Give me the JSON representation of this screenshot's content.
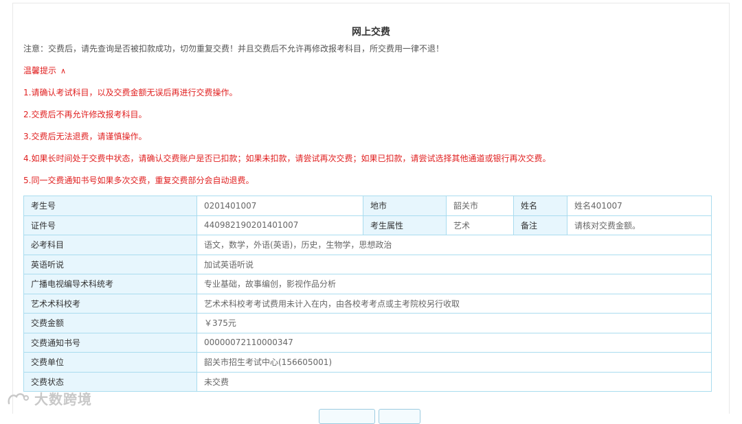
{
  "page": {
    "title": "网上交费",
    "notice": "注意：交费后，请先查询是否被扣款成功，切勿重复交费！并且交费后不允许再修改报考科目，所交费用一律不退！"
  },
  "tips": {
    "toggle_label": "温馨提示",
    "toggle_icon": "chevron-up-icon",
    "items": [
      "1.请确认考试科目，以及交费金额无误后再进行交费操作。",
      "2.交费后不再允许修改报考科目。",
      "3.交费后无法退费，请谨慎操作。",
      "4.如果长时间处于交费中状态，请确认交费账户是否已扣款；如果未扣款，请尝试再次交费；如果已扣款，请尝试选择其他通道或银行再次交费。",
      "5.同一交费通知书号如果多次交费，重复交费部分会自动退费。"
    ]
  },
  "table": {
    "row1": {
      "label1": "考生号",
      "value1": "0201401007",
      "label2": "地市",
      "value2": "韶关市",
      "label3": "姓名",
      "value3": "姓名401007"
    },
    "row2": {
      "label1": "证件号",
      "value1": "440982190201401007",
      "label2": "考生属性",
      "value2": "艺术",
      "label3": "备注",
      "value3": "请核对交费金额。"
    },
    "rows": [
      {
        "label": "必考科目",
        "value": "语文，数学，外语(英语)，历史，生物学，思想政治"
      },
      {
        "label": "英语听说",
        "value": "加试英语听说"
      },
      {
        "label": "广播电视编导术科统考",
        "value": "专业基础，故事编创，影视作品分析"
      },
      {
        "label": "艺术术科校考",
        "value": "艺术术科校考考试费用未计入在内，由各校考考点或主考院校另行收取"
      },
      {
        "label": "交费金额",
        "value": "￥375元"
      },
      {
        "label": "交费通知书号",
        "value": "00000072110000347"
      },
      {
        "label": "交费单位",
        "value": "韶关市招生考试中心(156605001)"
      },
      {
        "label": "交费状态",
        "value": "未交费"
      }
    ]
  },
  "watermark": {
    "text": "大数跨境"
  },
  "colors": {
    "warning_red": "#e02020",
    "table_border": "#a9dcef",
    "label_bg": "#e7f6fd"
  }
}
